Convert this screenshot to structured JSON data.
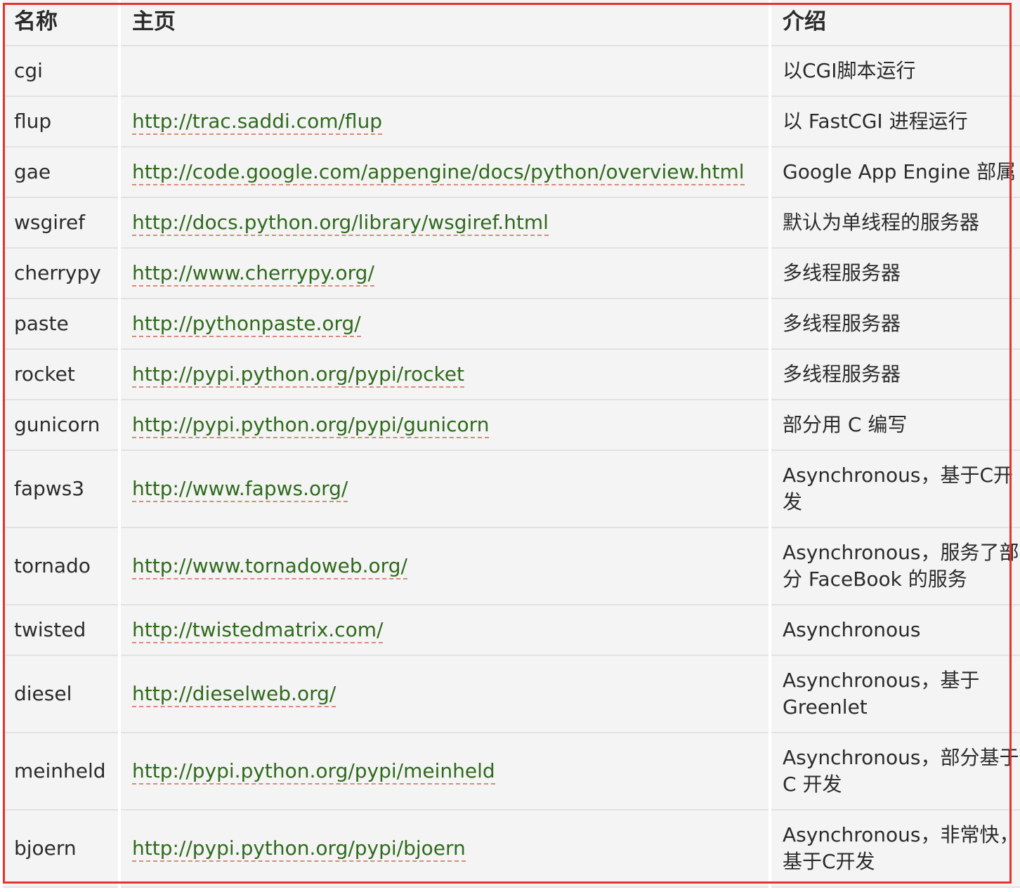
{
  "table": {
    "headers": {
      "name": "名称",
      "homepage": "主页",
      "intro": "介绍"
    },
    "rows": [
      {
        "name": "cgi",
        "url": "",
        "desc": "以CGI脚本运行",
        "tall": false
      },
      {
        "name": "flup",
        "url": "http://trac.saddi.com/flup",
        "desc": "以 FastCGI 进程运行",
        "tall": false
      },
      {
        "name": "gae",
        "url": "http://code.google.com/appengine/docs/python/overview.html",
        "desc": "Google App Engine 部属",
        "tall": false
      },
      {
        "name": "wsgiref",
        "url": "http://docs.python.org/library/wsgiref.html",
        "desc": "默认为单线程的服务器",
        "tall": false
      },
      {
        "name": "cherrypy",
        "url": "http://www.cherrypy.org/",
        "desc": "多线程服务器",
        "tall": false
      },
      {
        "name": "paste",
        "url": "http://pythonpaste.org/",
        "desc": "多线程服务器",
        "tall": false
      },
      {
        "name": "rocket",
        "url": "http://pypi.python.org/pypi/rocket",
        "desc": "多线程服务器",
        "tall": false
      },
      {
        "name": "gunicorn",
        "url": "http://pypi.python.org/pypi/gunicorn",
        "desc": "部分用 C 编写",
        "tall": false
      },
      {
        "name": "fapws3",
        "url": "http://www.fapws.org/",
        "desc": "Asynchronous，基于C开发",
        "tall": true
      },
      {
        "name": "tornado",
        "url": "http://www.tornadoweb.org/",
        "desc": "Asynchronous，服务了部分 FaceBook 的服务",
        "tall": true
      },
      {
        "name": "twisted",
        "url": "http://twistedmatrix.com/",
        "desc": "Asynchronous",
        "tall": false
      },
      {
        "name": "diesel",
        "url": "http://dieselweb.org/",
        "desc": "Asynchronous，基于 Greenlet",
        "tall": true
      },
      {
        "name": "meinheld",
        "url": "http://pypi.python.org/pypi/meinheld",
        "desc": "Asynchronous，部分基于 C 开发",
        "tall": true
      },
      {
        "name": "bjoern",
        "url": "http://pypi.python.org/pypi/bjoern",
        "desc": "Asynchronous，非常快，基于C开发",
        "tall": true
      }
    ]
  },
  "colors": {
    "link": "#2f6a1c",
    "highlight_border": "#e8322c",
    "cell_background": "#f4f4f4"
  }
}
